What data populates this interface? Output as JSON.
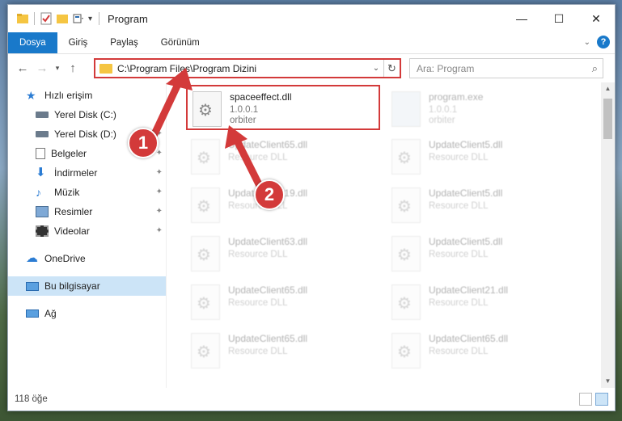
{
  "window": {
    "title": "Program",
    "min_label": "—",
    "max_label": "☐",
    "close_label": "✕"
  },
  "ribbon": {
    "tabs": [
      "Dosya",
      "Giriş",
      "Paylaş",
      "Görünüm"
    ]
  },
  "address": {
    "path": "C:\\Program Files\\Program Dizini",
    "search_placeholder": "Ara: Program"
  },
  "sidebar": {
    "items": [
      {
        "label": "Hızlı erişim",
        "icon": "star-icon"
      },
      {
        "label": "Yerel Disk (C:)",
        "icon": "drive-icon"
      },
      {
        "label": "Yerel Disk (D:)",
        "icon": "drive-icon"
      },
      {
        "label": "Belgeler",
        "icon": "document-icon"
      },
      {
        "label": "İndirmeler",
        "icon": "download-icon"
      },
      {
        "label": "Müzik",
        "icon": "music-icon"
      },
      {
        "label": "Resimler",
        "icon": "pictures-icon"
      },
      {
        "label": "Videolar",
        "icon": "video-icon"
      },
      {
        "label": "OneDrive",
        "icon": "cloud-icon"
      },
      {
        "label": "Bu bilgisayar",
        "icon": "computer-icon"
      },
      {
        "label": "Ağ",
        "icon": "network-icon"
      }
    ]
  },
  "files": [
    {
      "name": "spaceeffect.dll",
      "line2": "1.0.0.1",
      "line3": "orbiter"
    },
    {
      "name": "program.exe",
      "line2": "1.0.0.1",
      "line3": "orbiter"
    },
    {
      "name": "UpdateClient65.dll",
      "line2": "Resource DLL"
    },
    {
      "name": "UpdateClient5.dll",
      "line2": "Resource DLL"
    },
    {
      "name": "UpdateClient19.dll",
      "line2": "Resource DLL"
    },
    {
      "name": "UpdateClient5.dll",
      "line2": "Resource DLL"
    },
    {
      "name": "UpdateClient63.dll",
      "line2": "Resource DLL"
    },
    {
      "name": "UpdateClient5.dll",
      "line2": "Resource DLL"
    },
    {
      "name": "UpdateClient65.dll",
      "line2": "Resource DLL"
    },
    {
      "name": "UpdateClient21.dll",
      "line2": "Resource DLL"
    },
    {
      "name": "UpdateClient65.dll",
      "line2": "Resource DLL"
    },
    {
      "name": "UpdateClient65.dll",
      "line2": "Resource DLL"
    }
  ],
  "status": {
    "count": "118 öğe"
  },
  "annotations": {
    "marker1": "1",
    "marker2": "2",
    "color": "#d33a3a"
  }
}
